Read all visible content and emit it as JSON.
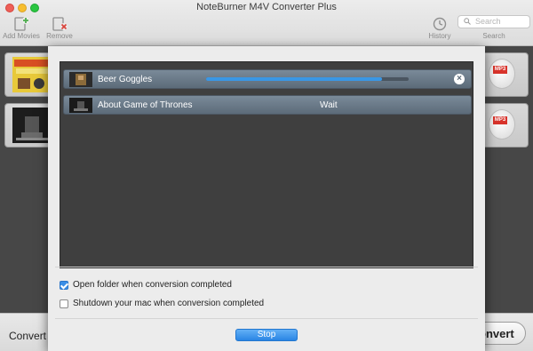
{
  "window": {
    "title": "NoteBurner M4V Converter Plus"
  },
  "toolbar": {
    "add_label": "Add Movies",
    "remove_label": "Remove",
    "history_label": "History",
    "search_label": "Search",
    "search_placeholder": "Search"
  },
  "queue": {
    "items": [
      {
        "title": "Beer Goggles",
        "progress": 0.87
      },
      {
        "title": "About Game of Thrones",
        "status": "Wait"
      }
    ]
  },
  "options": {
    "open_folder": {
      "label": "Open folder when conversion completed",
      "checked": true
    },
    "shutdown": {
      "label": "Shutdown your mac when conversion completed",
      "checked": false
    }
  },
  "actions": {
    "stop_label": "Stop"
  },
  "bottom": {
    "left_text": "Convert t",
    "convert_label": "onvert"
  },
  "badges": {
    "format": "MP3"
  },
  "colors": {
    "accent": "#3a97e5",
    "queue_row": "#6a7a89",
    "queue_bg": "#3f3f3f"
  }
}
